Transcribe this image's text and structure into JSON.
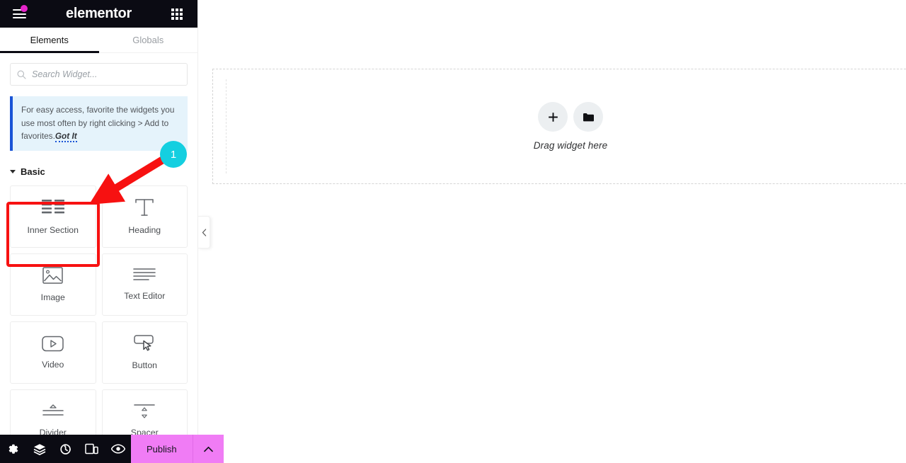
{
  "header": {
    "brand": "elementor",
    "menu_icon": "hamburger-menu-icon",
    "notification_dot_color": "#e624ca",
    "apps_icon": "app-grid-icon"
  },
  "tabs": [
    {
      "label": "Elements",
      "active": true
    },
    {
      "label": "Globals",
      "active": false
    }
  ],
  "search": {
    "placeholder": "Search Widget...",
    "value": "",
    "icon": "search-icon"
  },
  "notice": {
    "text": "For easy access, favorite the widgets you use most often by right clicking > Add to favorites.",
    "action_label": "Got It",
    "accent_color": "#1a54d6",
    "background_color": "#e5f3fb"
  },
  "category": {
    "label": "Basic",
    "expanded": true,
    "caret_icon": "caret-down-icon"
  },
  "widgets": [
    {
      "label": "Inner Section",
      "icon": "inner-section-icon",
      "highlighted": true
    },
    {
      "label": "Heading",
      "icon": "heading-icon",
      "highlighted": false
    },
    {
      "label": "Image",
      "icon": "image-icon",
      "highlighted": false
    },
    {
      "label": "Text Editor",
      "icon": "text-editor-icon",
      "highlighted": false
    },
    {
      "label": "Video",
      "icon": "video-icon",
      "highlighted": false
    },
    {
      "label": "Button",
      "icon": "button-icon",
      "highlighted": false
    },
    {
      "label": "Divider",
      "icon": "divider-icon",
      "highlighted": false
    },
    {
      "label": "Spacer",
      "icon": "spacer-icon",
      "highlighted": false
    }
  ],
  "annotation": {
    "badge_number": "1",
    "badge_color": "#14cfe0",
    "arrow_color": "#f71111",
    "highlight_color": "#f71111",
    "target": "Inner Section"
  },
  "panel_handle": {
    "icon": "chevron-left-icon"
  },
  "canvas": {
    "drop_label": "Drag widget here",
    "add_icon": "plus-icon",
    "folder_icon": "folder-icon"
  },
  "footer": {
    "icons": [
      {
        "name": "settings-gear-icon"
      },
      {
        "name": "layers-navigator-icon"
      },
      {
        "name": "history-icon"
      },
      {
        "name": "responsive-mode-icon"
      },
      {
        "name": "preview-eye-icon"
      }
    ],
    "publish_label": "Publish",
    "publish_color": "#f07cf5",
    "publish_caret_icon": "chevron-up-icon"
  }
}
